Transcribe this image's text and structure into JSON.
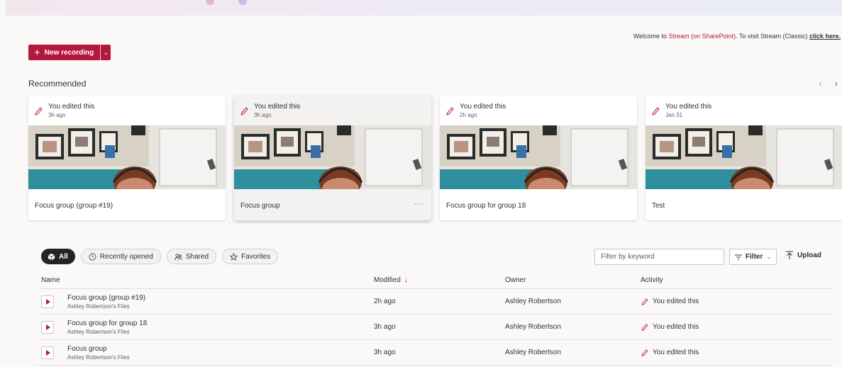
{
  "welcome": {
    "prefix": "Welcome to ",
    "stream_link": "Stream (on SharePoint)",
    "middle": ". To visit Stream (Classic) ",
    "classic_link": "click here."
  },
  "toolbar": {
    "new_recording_label": "New recording"
  },
  "recommended": {
    "title": "Recommended",
    "cards": [
      {
        "activity": "You edited this",
        "time": "3h ago",
        "title": "Focus group (group #19)"
      },
      {
        "activity": "You edited this",
        "time": "3h ago",
        "title": "Focus group"
      },
      {
        "activity": "You edited this",
        "time": "2h ago",
        "title": "Focus group for group 18"
      },
      {
        "activity": "You edited this",
        "time": "Jan 31",
        "title": "Test"
      }
    ]
  },
  "filters": {
    "pills": [
      "All",
      "Recently opened",
      "Shared",
      "Favorites"
    ],
    "keyword_placeholder": "Filter by keyword",
    "filter_label": "Filter",
    "upload_label": "Upload"
  },
  "table": {
    "columns": [
      "Name",
      "Modified",
      "Owner",
      "Activity"
    ],
    "rows": [
      {
        "name": "Focus group (group #19)",
        "location": "Ashley Robertson's Files",
        "modified": "2h ago",
        "owner": "Ashley Robertson",
        "activity": "You edited this"
      },
      {
        "name": "Focus group for group 18",
        "location": "Ashley Robertson's Files",
        "modified": "3h ago",
        "owner": "Ashley Robertson",
        "activity": "You edited this"
      },
      {
        "name": "Focus group",
        "location": "Ashley Robertson's Files",
        "modified": "3h ago",
        "owner": "Ashley Robertson",
        "activity": "You edited this"
      }
    ]
  },
  "colors": {
    "accent": "#b4173e",
    "background": "#faf9f8"
  }
}
